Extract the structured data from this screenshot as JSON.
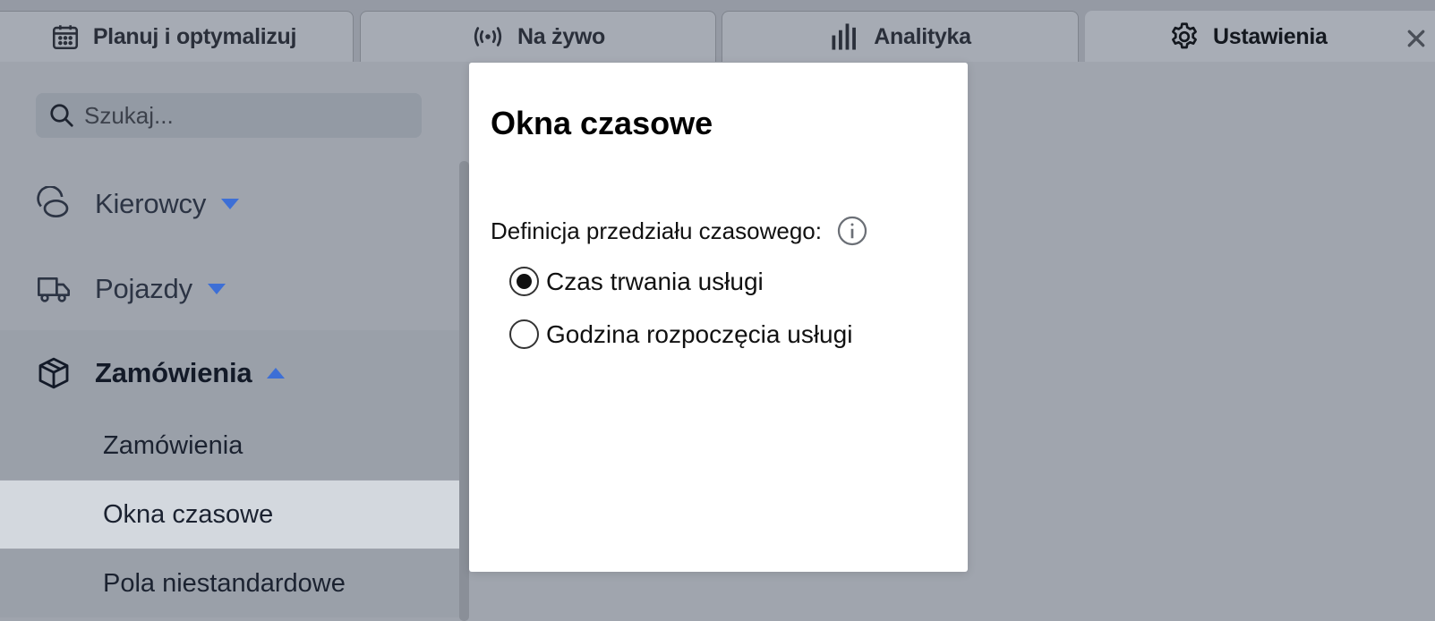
{
  "tabs": [
    {
      "label": "Planuj i optymalizuj",
      "icon": "calendar-icon"
    },
    {
      "label": "Na żywo",
      "icon": "broadcast-icon"
    },
    {
      "label": "Analityka",
      "icon": "bar-chart-icon"
    },
    {
      "label": "Ustawienia",
      "icon": "gear-icon",
      "active": true
    }
  ],
  "close_icon": "close-icon",
  "search": {
    "placeholder": "Szukaj...",
    "value": ""
  },
  "sidebar": {
    "drivers": {
      "label": "Kierowcy",
      "icon": "driver-icon",
      "expanded": false
    },
    "vehicles": {
      "label": "Pojazdy",
      "icon": "truck-icon",
      "expanded": false
    },
    "orders": {
      "label": "Zamówienia",
      "icon": "package-icon",
      "expanded": true,
      "items": [
        "Zamówienia",
        "Okna czasowe",
        "Pola niestandardowe"
      ],
      "selected": "Okna czasowe"
    }
  },
  "modal": {
    "title": "Okna czasowe",
    "field_label": "Definicja przedziału czasowego:",
    "options": [
      {
        "label": "Czas trwania usługi",
        "checked": true
      },
      {
        "label": "Godzina rozpoczęcia usługi",
        "checked": false
      }
    ]
  },
  "colors": {
    "accent": "#3d6fd6",
    "selected_row": "#d3d8de",
    "modal_bg": "#ffffff"
  }
}
